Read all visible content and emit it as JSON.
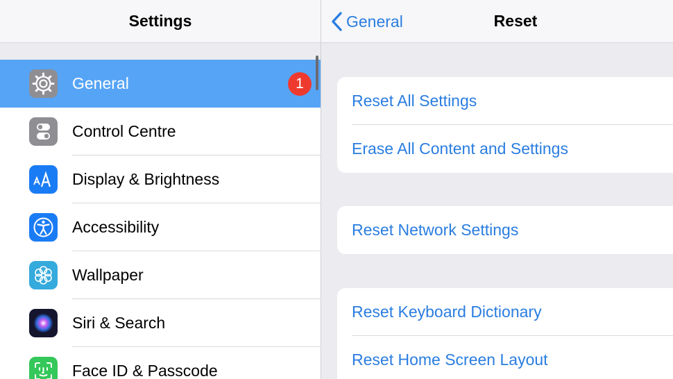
{
  "left": {
    "title": "Settings",
    "items": [
      {
        "label": "General",
        "icon": "gear-icon",
        "color": "#8e8e93",
        "badge": "1",
        "selected": true
      },
      {
        "label": "Control Centre",
        "icon": "toggle-icon",
        "color": "#8e8e93"
      },
      {
        "label": "Display & Brightness",
        "icon": "text-size-icon",
        "color": "#1a7cf5"
      },
      {
        "label": "Accessibility",
        "icon": "accessibility-icon",
        "color": "#1a7cf5"
      },
      {
        "label": "Wallpaper",
        "icon": "flower-icon",
        "color": "#35aadc"
      },
      {
        "label": "Siri & Search",
        "icon": "siri-icon",
        "color": "#1c1c3a"
      },
      {
        "label": "Face ID & Passcode",
        "icon": "face-id-icon",
        "color": "#34c759"
      }
    ]
  },
  "right": {
    "back_label": "General",
    "title": "Reset",
    "groups": [
      [
        "Reset All Settings",
        "Erase All Content and Settings"
      ],
      [
        "Reset Network Settings"
      ],
      [
        "Reset Keyboard Dictionary",
        "Reset Home Screen Layout"
      ]
    ]
  },
  "colors": {
    "accent": "#2a7de0",
    "selected_row": "#56a4f6",
    "badge": "#ee3a2e"
  }
}
